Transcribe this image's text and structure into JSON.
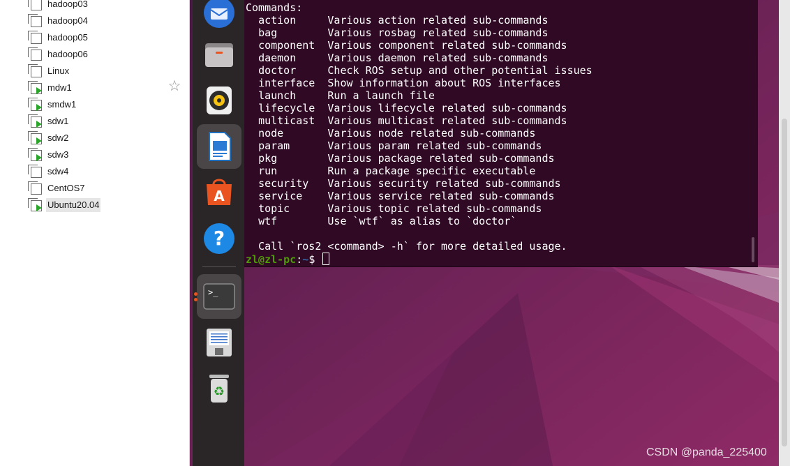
{
  "vm_library": {
    "items": [
      {
        "label": "hadoop03",
        "running": false,
        "selected": false
      },
      {
        "label": "hadoop04",
        "running": false,
        "selected": false
      },
      {
        "label": "hadoop05",
        "running": false,
        "selected": false
      },
      {
        "label": "hadoop06",
        "running": false,
        "selected": false
      },
      {
        "label": "Linux",
        "running": false,
        "selected": false
      },
      {
        "label": "mdw1",
        "running": true,
        "selected": false
      },
      {
        "label": "smdw1",
        "running": true,
        "selected": false
      },
      {
        "label": "sdw1",
        "running": true,
        "selected": false
      },
      {
        "label": "sdw2",
        "running": true,
        "selected": false
      },
      {
        "label": "sdw3",
        "running": true,
        "selected": false
      },
      {
        "label": "sdw4",
        "running": false,
        "selected": false
      },
      {
        "label": "CentOS7",
        "running": false,
        "selected": false
      },
      {
        "label": "Ubuntu20.04",
        "running": true,
        "selected": true
      }
    ],
    "star_icon": "star-outline-icon"
  },
  "dock": {
    "apps": [
      {
        "name": "thunderbird-icon"
      },
      {
        "name": "files-icon"
      },
      {
        "name": "rhythmbox-icon"
      },
      {
        "name": "libreoffice-writer-icon"
      },
      {
        "name": "app-center-icon"
      },
      {
        "name": "help-icon"
      },
      {
        "name": "terminal-icon"
      },
      {
        "name": "text-editor-icon"
      },
      {
        "name": "trash-icon"
      }
    ]
  },
  "terminal": {
    "heading": "Commands:",
    "commands": [
      {
        "name": "action",
        "desc": "Various action related sub-commands"
      },
      {
        "name": "bag",
        "desc": "Various rosbag related sub-commands"
      },
      {
        "name": "component",
        "desc": "Various component related sub-commands"
      },
      {
        "name": "daemon",
        "desc": "Various daemon related sub-commands"
      },
      {
        "name": "doctor",
        "desc": "Check ROS setup and other potential issues"
      },
      {
        "name": "interface",
        "desc": "Show information about ROS interfaces"
      },
      {
        "name": "launch",
        "desc": "Run a launch file"
      },
      {
        "name": "lifecycle",
        "desc": "Various lifecycle related sub-commands"
      },
      {
        "name": "multicast",
        "desc": "Various multicast related sub-commands"
      },
      {
        "name": "node",
        "desc": "Various node related sub-commands"
      },
      {
        "name": "param",
        "desc": "Various param related sub-commands"
      },
      {
        "name": "pkg",
        "desc": "Various package related sub-commands"
      },
      {
        "name": "run",
        "desc": "Run a package specific executable"
      },
      {
        "name": "security",
        "desc": "Various security related sub-commands"
      },
      {
        "name": "service",
        "desc": "Various service related sub-commands"
      },
      {
        "name": "topic",
        "desc": "Various topic related sub-commands"
      },
      {
        "name": "wtf",
        "desc": "Use `wtf` as alias to `doctor`"
      }
    ],
    "footer": "Call `ros2 <command> -h` for more detailed usage.",
    "prompt_user": "zl@zl-pc",
    "prompt_sep": ":",
    "prompt_path": "~",
    "prompt_symbol": "$"
  },
  "watermark": "CSDN @panda_225400",
  "colors": {
    "terminal_bg": "#300a24",
    "prompt_user": "#4e9a06",
    "prompt_path": "#3465a4",
    "dock_bg": "#2a2627",
    "running_indicator": "#e95420"
  }
}
